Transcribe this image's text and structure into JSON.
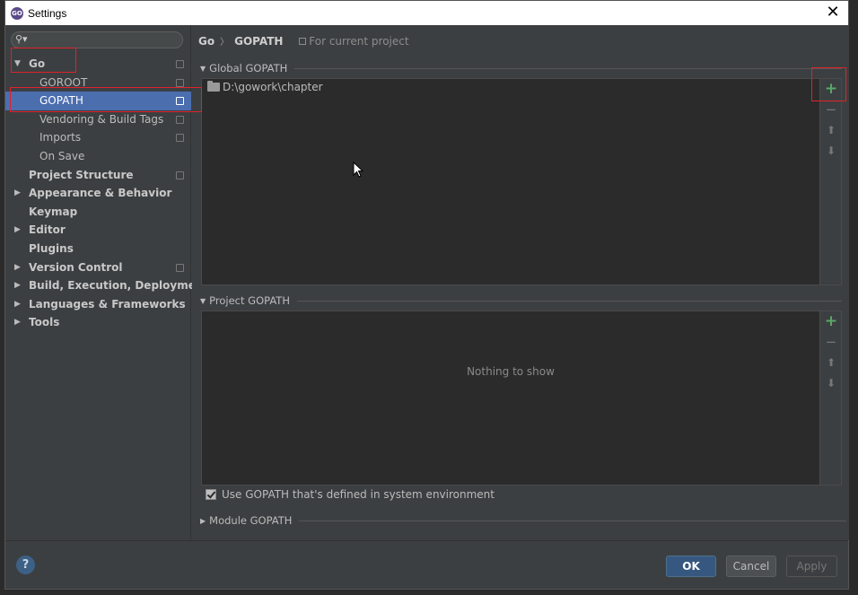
{
  "window": {
    "title": "Settings"
  },
  "search": {
    "placeholder": ""
  },
  "sidebar": {
    "items": [
      {
        "label": "Go",
        "arrow": "▼",
        "bold": true,
        "level": 0,
        "cfg": true
      },
      {
        "label": "GOROOT",
        "level": 1,
        "cfg": true
      },
      {
        "label": "GOPATH",
        "level": 1,
        "cfg": true,
        "selected": true
      },
      {
        "label": "Vendoring & Build Tags",
        "level": 1,
        "cfg": true
      },
      {
        "label": "Imports",
        "level": 1,
        "cfg": true
      },
      {
        "label": "On Save",
        "level": 1
      },
      {
        "label": "Project Structure",
        "bold": true,
        "level": 0,
        "cfg": true
      },
      {
        "label": "Appearance & Behavior",
        "arrow": "▶",
        "bold": true,
        "level": 0
      },
      {
        "label": "Keymap",
        "bold": true,
        "level": 0
      },
      {
        "label": "Editor",
        "arrow": "▶",
        "bold": true,
        "level": 0
      },
      {
        "label": "Plugins",
        "bold": true,
        "level": 0
      },
      {
        "label": "Version Control",
        "arrow": "▶",
        "bold": true,
        "level": 0,
        "cfg": true
      },
      {
        "label": "Build, Execution, Deployment",
        "arrow": "▶",
        "bold": true,
        "level": 0
      },
      {
        "label": "Languages & Frameworks",
        "arrow": "▶",
        "bold": true,
        "level": 0
      },
      {
        "label": "Tools",
        "arrow": "▶",
        "bold": true,
        "level": 0
      }
    ]
  },
  "breadcrumb": {
    "parent": "Go",
    "sep": "〉",
    "current": "GOPATH",
    "scope": "For current project"
  },
  "global_gopath": {
    "title": "Global GOPATH",
    "entries": [
      "D:\\gowork\\chapter"
    ]
  },
  "project_gopath": {
    "title": "Project GOPATH",
    "empty_text": "Nothing to show"
  },
  "tools": {
    "add": "+",
    "remove": "−",
    "up": "⬆",
    "down": "⬇"
  },
  "use_system_gopath": {
    "label": "Use GOPATH that's defined in system environment",
    "checked": true
  },
  "module_gopath": {
    "title": "Module GOPATH"
  },
  "footer": {
    "help": "?",
    "ok": "OK",
    "cancel": "Cancel",
    "apply": "Apply"
  },
  "colors": {
    "accent": "#4b6eaf",
    "add": "#59a869",
    "highlight": "#e0222a"
  }
}
